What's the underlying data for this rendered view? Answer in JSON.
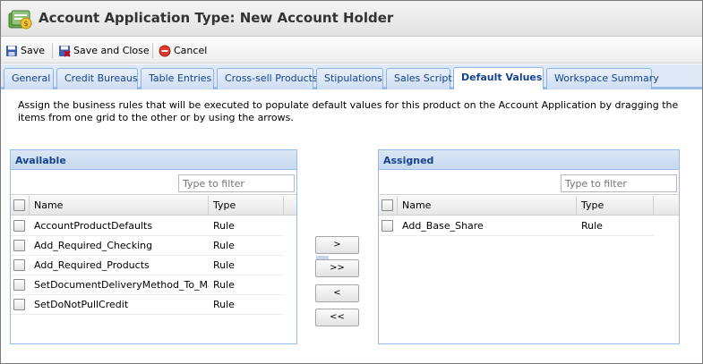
{
  "window": {
    "title": "Account Application Type: New Account Holder",
    "app_icon": "account-application-icon"
  },
  "toolbar": {
    "save_label": "Save",
    "save_close_label": "Save and Close",
    "cancel_label": "Cancel"
  },
  "tabs": [
    {
      "label": "General"
    },
    {
      "label": "Credit Bureaus"
    },
    {
      "label": "Table Entries"
    },
    {
      "label": "Cross-sell Products"
    },
    {
      "label": "Stipulations"
    },
    {
      "label": "Sales Script"
    },
    {
      "label": "Default Values",
      "active": true
    },
    {
      "label": "Workspace Summary"
    }
  ],
  "description": "Assign the business rules that will be executed to populate default values for this product on the Account Application by dragging the items from one grid to the other or by using the arrows.",
  "available": {
    "title": "Available",
    "filter_placeholder": "Type to filter",
    "col_name": "Name",
    "col_type": "Type",
    "rows": [
      {
        "name": "AccountProductDefaults",
        "type": "Rule"
      },
      {
        "name": "Add_Required_Checking",
        "type": "Rule"
      },
      {
        "name": "Add_Required_Products",
        "type": "Rule"
      },
      {
        "name": "SetDocumentDeliveryMethod_To_Mail",
        "type": "Rule"
      },
      {
        "name": "SetDoNotPullCredit",
        "type": "Rule"
      }
    ]
  },
  "assigned": {
    "title": "Assigned",
    "filter_placeholder": "Type to filter",
    "col_name": "Name",
    "col_type": "Type",
    "rows": [
      {
        "name": "Add_Base_Share",
        "type": "Rule"
      }
    ]
  },
  "arrows": {
    "move_right": ">",
    "move_all_right": ">>",
    "move_left": "<",
    "move_all_left": "<<"
  }
}
